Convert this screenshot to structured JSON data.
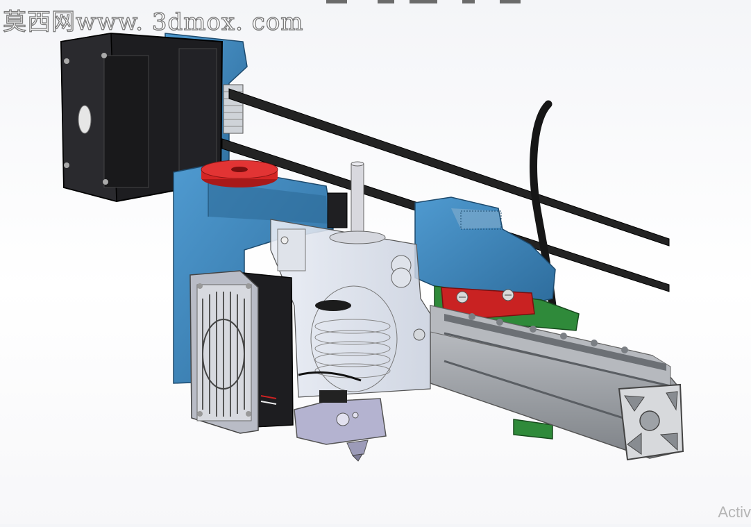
{
  "watermark": {
    "text": "莫西网www. 3dmox. com"
  },
  "activation": {
    "text": "Activ"
  },
  "colors": {
    "frame_blue": "#3b82b9",
    "frame_blue_dark": "#24587f",
    "motor_black": "#1c1c1e",
    "accent_red": "#d42525",
    "rail_green": "#2f8a3a",
    "extrusion_gray": "#9a9ea3",
    "hotend_lavender": "#b4b3d0",
    "belt_black": "#222222"
  },
  "icons": [
    "stepper-motor-icon",
    "fan-guard-icon",
    "aluminum-extrusion-icon"
  ]
}
